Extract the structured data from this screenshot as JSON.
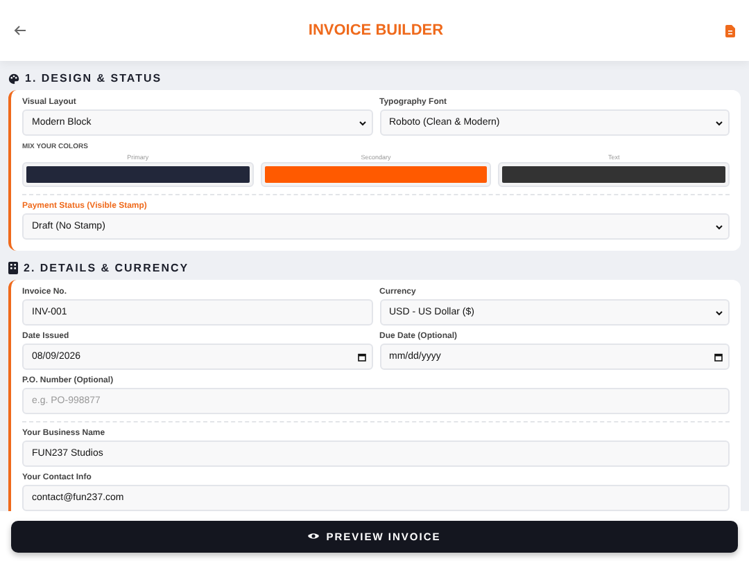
{
  "header": {
    "title": "INVOICE BUILDER"
  },
  "sections": [
    {
      "title": "1. DESIGN & STATUS",
      "blocks": [
        {
          "kind": "row",
          "fields": [
            {
              "kind": "select",
              "label": "Visual Layout",
              "value": "Modern Block"
            },
            {
              "kind": "select",
              "label": "Typography Font",
              "value": "Roboto (Clean & Modern)"
            }
          ]
        },
        {
          "kind": "colors",
          "label": "MIX YOUR COLORS",
          "swatches": [
            {
              "label": "Primary",
              "color": "#22273a"
            },
            {
              "label": "Secondary",
              "color": "#ff5a00"
            },
            {
              "label": "Text",
              "color": "#333333"
            }
          ]
        },
        {
          "kind": "divider"
        },
        {
          "kind": "row",
          "fields": [
            {
              "kind": "select",
              "label": "Payment Status (Visible Stamp)",
              "accent": true,
              "value": "Draft (No Stamp)"
            }
          ]
        }
      ]
    },
    {
      "title": "2. DETAILS & CURRENCY",
      "blocks": [
        {
          "kind": "row",
          "fields": [
            {
              "kind": "text",
              "label": "Invoice No.",
              "value": "INV-001"
            },
            {
              "kind": "select",
              "label": "Currency",
              "value": "USD - US Dollar ($)"
            }
          ]
        },
        {
          "kind": "row",
          "fields": [
            {
              "kind": "date",
              "label": "Date Issued",
              "value": "08/09/2026"
            },
            {
              "kind": "date",
              "label": "Due Date (Optional)",
              "value": "mm/dd/yyyy"
            }
          ]
        },
        {
          "kind": "row",
          "fields": [
            {
              "kind": "text",
              "label": "P.O. Number (Optional)",
              "placeholder": "e.g. PO-998877"
            }
          ]
        },
        {
          "kind": "divider"
        },
        {
          "kind": "row",
          "fields": [
            {
              "kind": "text",
              "label": "Your Business Name",
              "value": "FUN237 Studios"
            }
          ]
        },
        {
          "kind": "row",
          "fields": [
            {
              "kind": "text",
              "label": "Your Contact Info",
              "value": "contact@fun237.com"
            }
          ]
        }
      ]
    }
  ],
  "footer": {
    "button": "PREVIEW INVOICE"
  }
}
